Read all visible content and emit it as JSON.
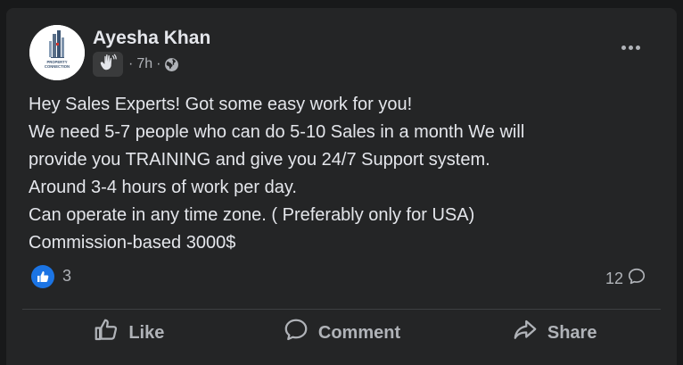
{
  "post": {
    "author": "Ayesha Khan",
    "avatar_logo_text": "PROPERTY CONNECTION",
    "audience_badge_icon": "waving-hand-icon",
    "time": "7h",
    "separator": "·",
    "privacy_icon": "globe-icon",
    "body_lines": [
      "Hey Sales Experts! Got some easy work for you!",
      "We need 5-7 people who can do 5-10 Sales in a month We will",
      "provide you TRAINING and give you 24/7 Support system.",
      "Around 3-4 hours of work per day.",
      "Can operate in any time zone. ( Preferably only for USA)",
      "Commission-based 3000$"
    ]
  },
  "reactions": {
    "like_count": "3",
    "comment_count": "12"
  },
  "actions": {
    "like_label": "Like",
    "comment_label": "Comment",
    "share_label": "Share"
  },
  "colors": {
    "background": "#18191a",
    "card": "#242526",
    "text_primary": "#e4e6eb",
    "text_secondary": "#b0b3b8",
    "like_blue": "#1b74e4",
    "divider": "#3e4042"
  }
}
